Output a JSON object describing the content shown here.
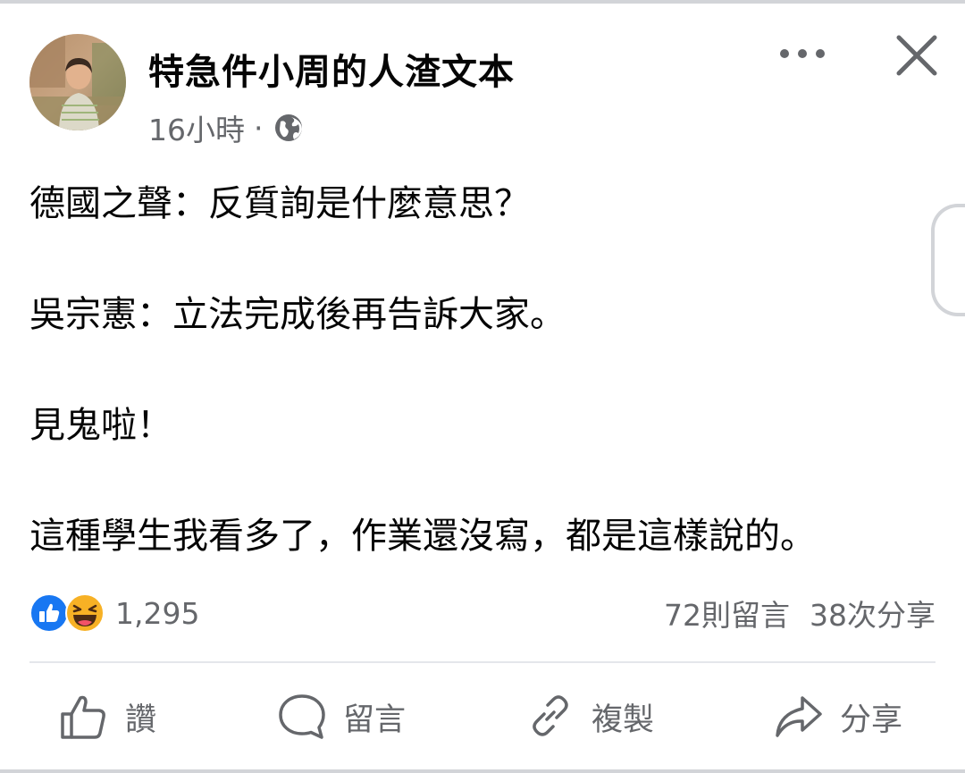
{
  "post": {
    "author_name": "特急件小周的人渣文本",
    "time": "16小時",
    "separator": "·",
    "body_lines": [
      "德國之聲：反質詢是什麼意思？",
      "吳宗憲：立法完成後再告訴大家。",
      "見鬼啦！",
      "這種學生我看多了，作業還沒寫，都是這樣說的。"
    ]
  },
  "reactions": {
    "count": "1,295",
    "types": [
      "like-icon",
      "haha-icon"
    ]
  },
  "stats": {
    "comments": "72則留言",
    "shares": "38次分享"
  },
  "actions": {
    "like": "讚",
    "comment": "留言",
    "copy": "複製",
    "share": "分享"
  },
  "colors": {
    "like_blue": "#1877f2",
    "haha_yellow": "#f7b125",
    "secondary_text": "#65676b"
  }
}
